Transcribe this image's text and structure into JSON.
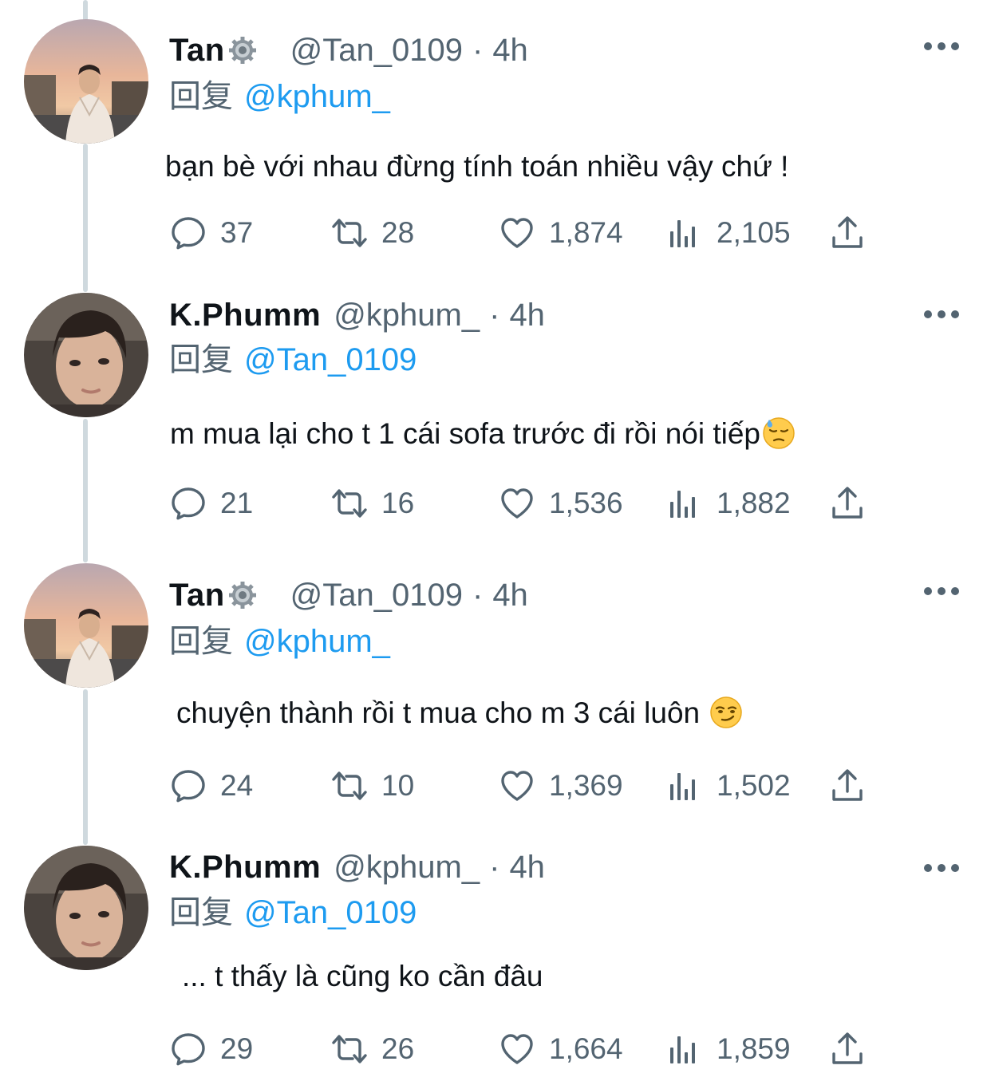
{
  "tweets": [
    {
      "name": "Tan",
      "has_badge": true,
      "handle": "@Tan_0109",
      "dot": "·",
      "time": "4h",
      "reply_prefix": "回复",
      "reply_to": "@kphum_",
      "text": "bạn bè với nhau đừng tính toán nhiều vậy chứ !",
      "emoji": "",
      "stats": {
        "replies": "37",
        "retweets": "28",
        "likes": "1,874",
        "views": "2,105"
      }
    },
    {
      "name": "K.Phumm",
      "has_badge": false,
      "handle": "@kphum_",
      "dot": "·",
      "time": "4h",
      "reply_prefix": "回复",
      "reply_to": "@Tan_0109",
      "text": "m mua lại cho t 1 cái sofa trước đi rồi nói tiếp",
      "emoji": "downcast-face-with-sweat-emoji",
      "stats": {
        "replies": "21",
        "retweets": "16",
        "likes": "1,536",
        "views": "1,882"
      }
    },
    {
      "name": "Tan",
      "has_badge": true,
      "handle": "@Tan_0109",
      "dot": "·",
      "time": "4h",
      "reply_prefix": "回复",
      "reply_to": "@kphum_",
      "text": "chuyện thành rồi t mua cho m 3 cái luôn ",
      "emoji": "smirking-face-emoji",
      "stats": {
        "replies": "24",
        "retweets": "10",
        "likes": "1,369",
        "views": "1,502"
      }
    },
    {
      "name": "K.Phumm",
      "has_badge": false,
      "handle": "@kphum_",
      "dot": "·",
      "time": "4h",
      "reply_prefix": "回复",
      "reply_to": "@Tan_0109",
      "text": "... t thấy là cũng ko cần đâu",
      "emoji": "",
      "stats": {
        "replies": "29",
        "retweets": "26",
        "likes": "1,664",
        "views": "1,859"
      }
    }
  ],
  "colors": {
    "accent": "#1d9bf0",
    "muted": "#536471",
    "text": "#0f1419",
    "thread_line": "#cfd9de"
  },
  "icons": [
    "reply-icon",
    "retweet-icon",
    "like-icon",
    "views-icon",
    "share-icon",
    "more-icon",
    "gear-badge-icon"
  ]
}
